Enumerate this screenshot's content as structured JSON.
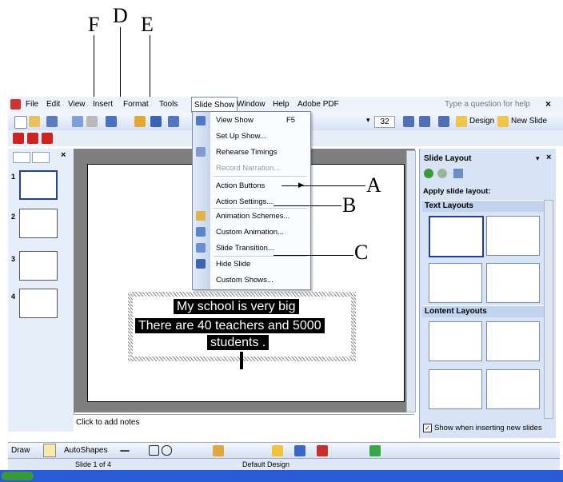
{
  "callouts": {
    "f": "F",
    "d": "D",
    "e": "E",
    "a": "A",
    "b": "B",
    "c": "C"
  },
  "menubar": {
    "items": [
      "File",
      "Edit",
      "View",
      "Insert",
      "Format",
      "Tools",
      "Slide Show",
      "Window",
      "Help",
      "Adobe PDF"
    ],
    "help_placeholder": "Type a question for help",
    "close": "×"
  },
  "toolbar": {
    "font_size": "32",
    "design": "Design",
    "new_slide": "New Slide"
  },
  "slideshow_menu": {
    "items": [
      {
        "label": "View Show",
        "shortcut": "F5"
      },
      {
        "label": "Set Up Show..."
      },
      {
        "label": "Rehearse Timings"
      },
      {
        "label": "Record Narration..."
      },
      {
        "label": "Action Buttons"
      },
      {
        "label": "Action Settings..."
      },
      {
        "label": "Animation Schemes..."
      },
      {
        "label": "Custom Animation..."
      },
      {
        "label": "Slide Transition..."
      },
      {
        "label": "Hide Slide"
      },
      {
        "label": "Custom Shows..."
      }
    ]
  },
  "slide": {
    "line1": "My school is very big",
    "line2": "There are 40 teachers  and  5000",
    "line3": "students ."
  },
  "thumbnails": [
    "1",
    "2",
    "3",
    "4"
  ],
  "notes_placeholder": "Click to add notes",
  "taskpane": {
    "title": "Slide Layout",
    "apply_label": "Apply slide layout:",
    "text_layouts": "Text Layouts",
    "content_layouts": "Lontent Layouts",
    "show_when_inserting": "Show when inserting new slides"
  },
  "drawbar": {
    "draw": "Draw",
    "autoshapes": "AutoShapes"
  },
  "status": {
    "slide": "Slide 1 of 4",
    "design": "Default Design"
  },
  "colors": {
    "menubar": "#eef3fb",
    "accent": "#316ac5",
    "workspace": "#7f7f7f",
    "taskbar": "#2a5bd7"
  }
}
